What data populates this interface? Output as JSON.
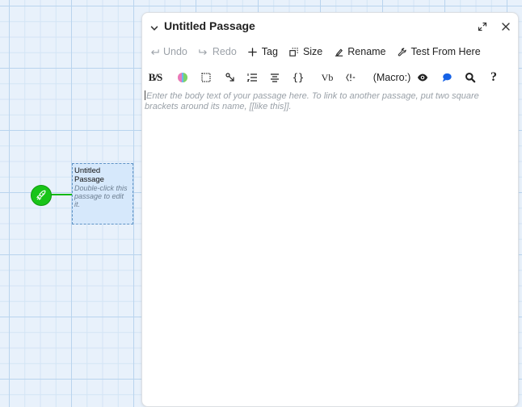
{
  "story_map": {
    "passage": {
      "title": "Untitled Passage",
      "excerpt": "Double-click this passage to edit it."
    },
    "start_icon": "rocket-icon",
    "colors": {
      "grid_background": "#e8f1fb",
      "start_badge": "#19c419",
      "selected_passage_fill": "#d6e8fb"
    }
  },
  "dialog": {
    "title": "Untitled Passage",
    "collapse_icon": "chevron-down-icon",
    "maximize_icon": "expand-icon",
    "close_icon": "close-icon",
    "toolbar": {
      "undo": "Undo",
      "redo": "Redo",
      "tag": "Tag",
      "size": "Size",
      "rename": "Rename",
      "test_from_here": "Test From Here"
    },
    "format_toolbar": {
      "bold_strike": "B/S",
      "code": "{}",
      "vb": "Vb",
      "macro": "(Macro:)",
      "help": "?"
    },
    "body_placeholder": "Enter the body text of your passage here. To link to another passage, put two square brackets around its name, [[like this]]."
  }
}
